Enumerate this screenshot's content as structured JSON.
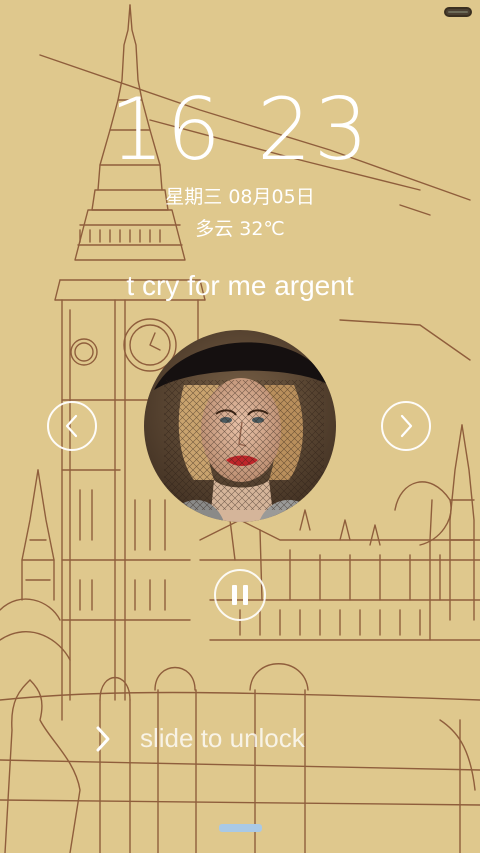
{
  "status_bar": {
    "battery_icon": "battery-icon",
    "battery_level": 0.85
  },
  "lockscreen": {
    "time_hour": "16",
    "time_minute": "23",
    "date": "星期三 08月05日",
    "weather": "多云 32℃"
  },
  "music": {
    "song_title": "t cry for me argent",
    "album_art_icon": "album-art",
    "prev_icon": "chevron-left-icon",
    "next_icon": "chevron-right-icon",
    "pause_icon": "pause-icon"
  },
  "unlock": {
    "label": "slide to unlock",
    "chevron_icon": "chevron-right-icon"
  },
  "colors": {
    "background": "#dfc88d",
    "line_art": "#8a5a3a",
    "text": "#ffffff",
    "home_indicator": "#a9c9e6"
  }
}
